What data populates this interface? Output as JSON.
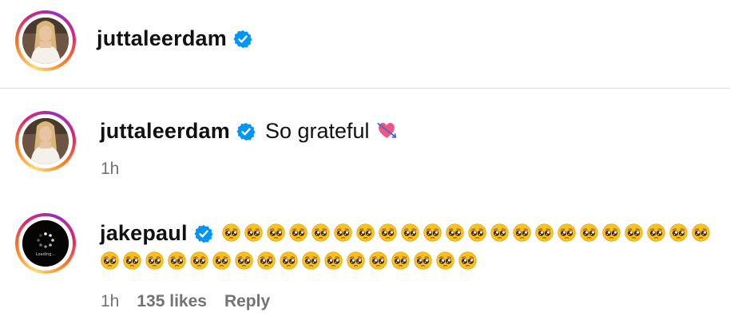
{
  "post_header": {
    "username": "juttaleerdam",
    "verified": true
  },
  "comments": [
    {
      "username": "juttaleerdam",
      "verified": true,
      "text": "So grateful",
      "emoji": "heart-with-arrow",
      "time": "1h"
    },
    {
      "username": "jakepaul",
      "verified": true,
      "emoji": "pleading-face",
      "emoji_count_line1": 22,
      "emoji_count_line2": 17,
      "avatar_text": "Loading...",
      "time": "1h",
      "likes": "135 likes",
      "reply_label": "Reply"
    }
  ],
  "colors": {
    "verified_blue": "#0095f6",
    "meta_gray": "#737373",
    "divider": "#dbdbdb"
  }
}
